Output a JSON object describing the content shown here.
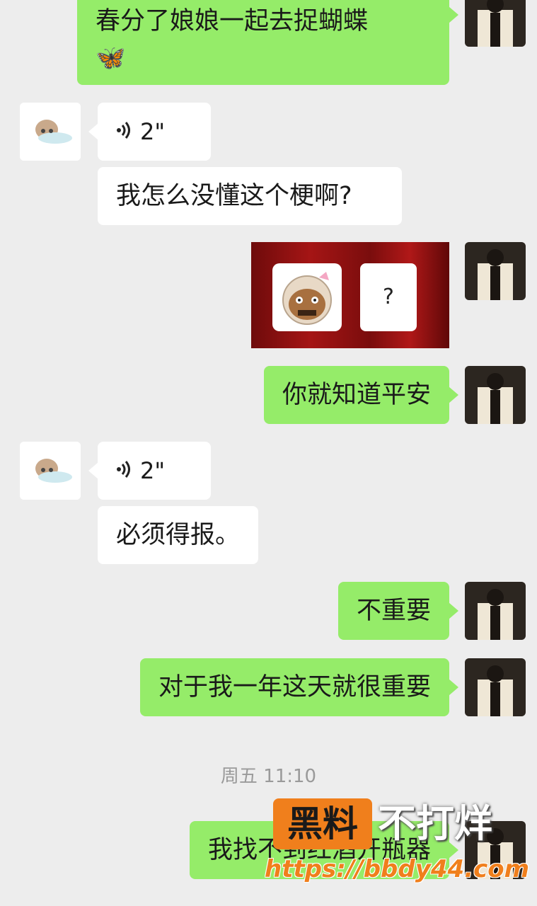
{
  "messages": [
    {
      "side": "me",
      "text": "春分了娘娘一起去捉蝴蝶",
      "emoji": "🦋"
    },
    {
      "side": "other",
      "voice_duration": "2\""
    },
    {
      "side": "other",
      "text": "我怎么没懂这个梗啊?"
    },
    {
      "side": "me",
      "sticker_text": "?"
    },
    {
      "side": "me",
      "text": "你就知道平安"
    },
    {
      "side": "other",
      "voice_duration": "2\""
    },
    {
      "side": "other",
      "text": "必须得报。"
    },
    {
      "side": "me",
      "text": "不重要"
    },
    {
      "side": "me",
      "text": "对于我一年这天就很重要"
    },
    {
      "side": "me",
      "text": "我找不到红酒开瓶器"
    }
  ],
  "timestamp": "周五 11:10",
  "watermark": {
    "brand_box": "黑料",
    "brand_text": "不打烊",
    "url": "https://bbdy44.com"
  },
  "colors": {
    "me_bubble": "#95ec69",
    "other_bubble": "#ffffff",
    "background": "#ededed",
    "watermark": "#f07f1c"
  }
}
